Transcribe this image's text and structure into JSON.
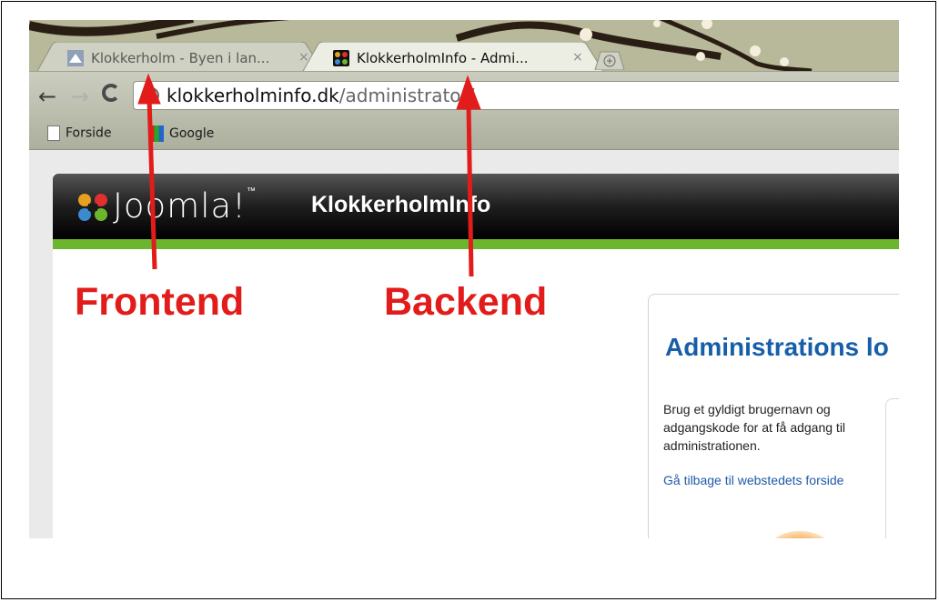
{
  "browser": {
    "tabs": [
      {
        "title": "Klokkerholm - Byen i lan...",
        "close": "×",
        "active": false
      },
      {
        "title": "KlokkerholmInfo - Admi...",
        "close": "×",
        "active": true
      }
    ],
    "new_tab_icon": "plus-icon",
    "nav": {
      "back": "←",
      "forward": "→"
    },
    "url_host": "klokkerholminfo.dk",
    "url_path": "/administrator/",
    "bookmarks": [
      {
        "label": "Forside",
        "icon": "page-icon"
      },
      {
        "label": "Google",
        "icon": "google-icon"
      }
    ]
  },
  "site": {
    "logo_text": "Joomla!",
    "logo_tm": "™",
    "site_name": "KlokkerholmInfo",
    "header_color": "#000000",
    "accent_color": "#6cb62e"
  },
  "login": {
    "title": "Administrations lo",
    "description": "Brug et gyldigt brugernavn og adgangskode for at få adgang til administrationen.",
    "back_link": "Gå tilbage til webstedets forside",
    "title_color": "#165ea8"
  },
  "annotations": {
    "frontend": "Frontend",
    "backend": "Backend",
    "color": "#e21b1b"
  }
}
